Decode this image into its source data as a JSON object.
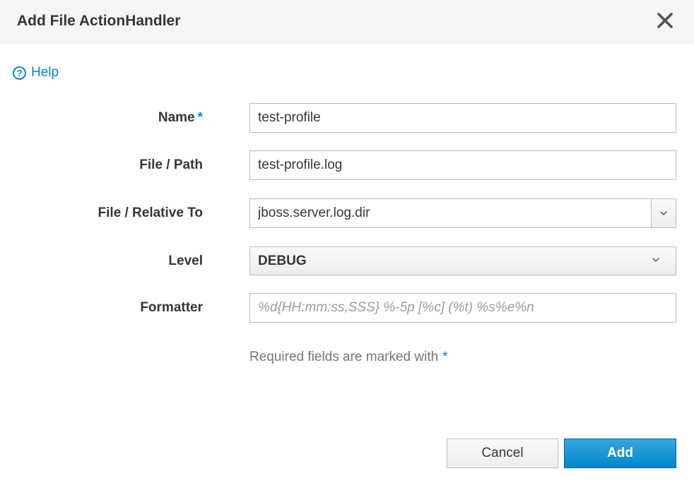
{
  "dialog": {
    "title": "Add File ActionHandler",
    "close_icon": "close-icon"
  },
  "help": {
    "label": "Help",
    "icon": "question-circle-icon"
  },
  "form": {
    "name": {
      "label": "Name",
      "required_marker": "*",
      "value": "test-profile"
    },
    "file_path": {
      "label": "File / Path",
      "value": "test-profile.log"
    },
    "relative_to": {
      "label": "File / Relative To",
      "value": "jboss.server.log.dir",
      "icon": "chevron-down-icon"
    },
    "level": {
      "label": "Level",
      "value": "DEBUG",
      "icon": "chevron-down-icon"
    },
    "formatter": {
      "label": "Formatter",
      "value": "",
      "placeholder": "%d{HH:mm:ss,SSS} %-5p [%c] (%t) %s%e%n"
    },
    "required_note": "Required fields are marked with",
    "required_note_marker": "*"
  },
  "buttons": {
    "cancel": "Cancel",
    "add": "Add"
  },
  "colors": {
    "accent": "#0088ce",
    "header_bg": "#f5f5f5",
    "text": "#363636",
    "muted": "#72767b"
  }
}
